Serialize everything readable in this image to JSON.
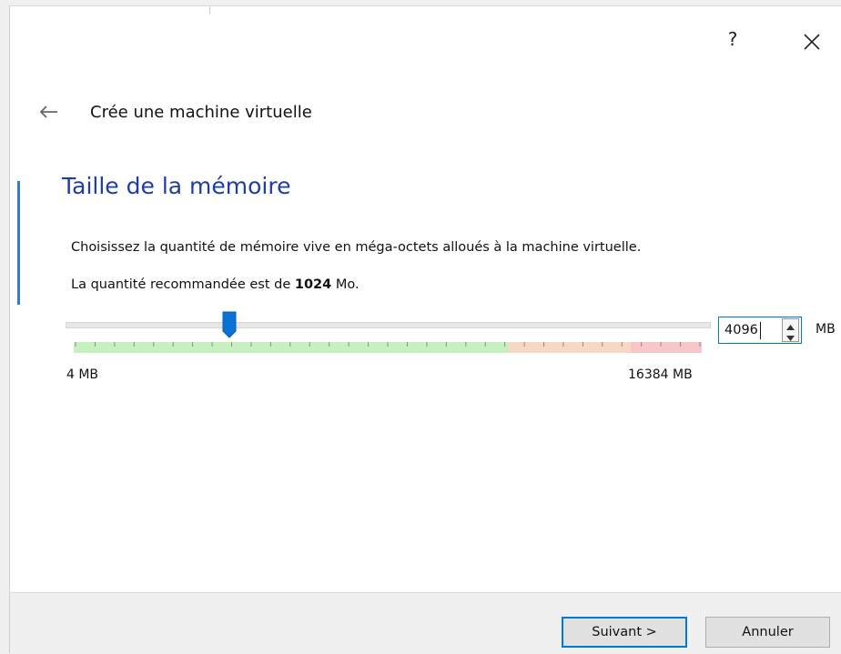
{
  "header": {
    "help_label": "?",
    "wizard_title": "Crée une machine virtuelle"
  },
  "page": {
    "heading": "Taille de la mémoire",
    "description": "Choisissez la quantité de mémoire vive en méga-octets alloués à la machine virtuelle.",
    "recommend_prefix": "La quantité recommandée est de",
    "recommend_value": "1024",
    "recommend_suffix": "Mo."
  },
  "memory": {
    "value": "4096",
    "unit": "MB",
    "min_label": "4 MB",
    "max_label": "16384 MB",
    "min_mb": 4,
    "max_mb": 16384,
    "current_mb": 4096,
    "zone_colors": {
      "safe": "#c6f0c0",
      "warning": "#f7d8c6",
      "danger": "#f7c6c6"
    }
  },
  "footer": {
    "next_label": "Suivant >",
    "cancel_label": "Annuler"
  },
  "icons": {
    "back": "left-arrow-icon",
    "close": "close-icon",
    "spin_up": "triangle-up-icon",
    "spin_down": "triangle-down-icon"
  },
  "colors": {
    "accent": "#0078d7",
    "heading": "#1f3ea5"
  }
}
